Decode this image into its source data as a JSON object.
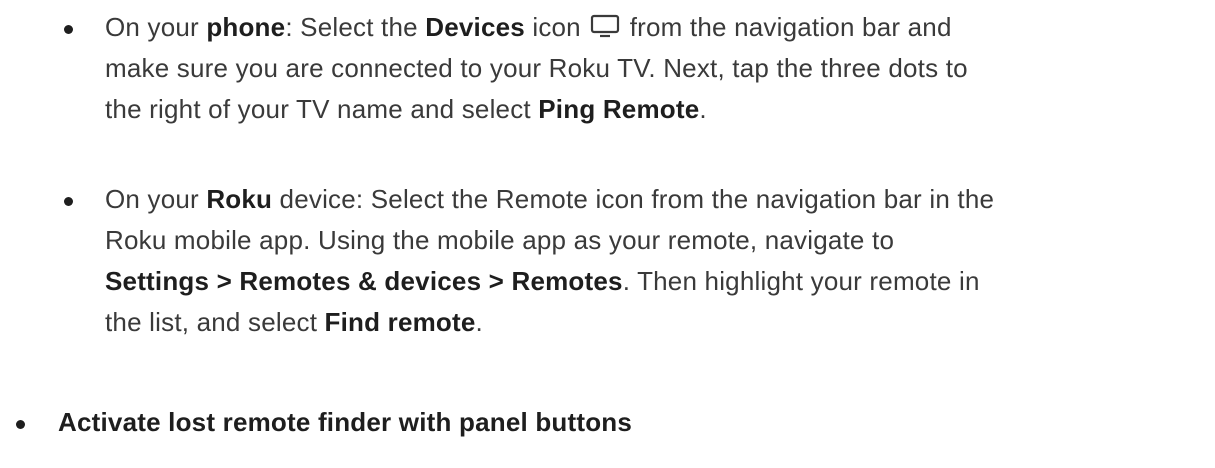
{
  "instructions": {
    "phone": {
      "t1": "On your ",
      "phone": "phone",
      "t2": ": Select the ",
      "devices": "Devices",
      "t3": " icon ",
      "icon": "devices-icon",
      "t4": " from the navigation bar and",
      "line2": "make sure you are connected to your Roku TV. Next, tap the three dots to",
      "t5": "the right of your TV name and select ",
      "ping_remote": "Ping Remote",
      "t6": "."
    },
    "roku": {
      "t1": "On your ",
      "roku": "Roku",
      "t2": " device: Select the Remote icon from the navigation bar in the",
      "line2": "Roku mobile app. Using the mobile app as your remote, navigate to",
      "settings_path": "Settings > Remotes & devices > Remotes",
      "t3": ". Then highlight your remote in",
      "t4": "the list, and select ",
      "find_remote": "Find remote",
      "t5": "."
    },
    "panel_buttons_heading": "Activate lost remote finder with panel buttons"
  }
}
